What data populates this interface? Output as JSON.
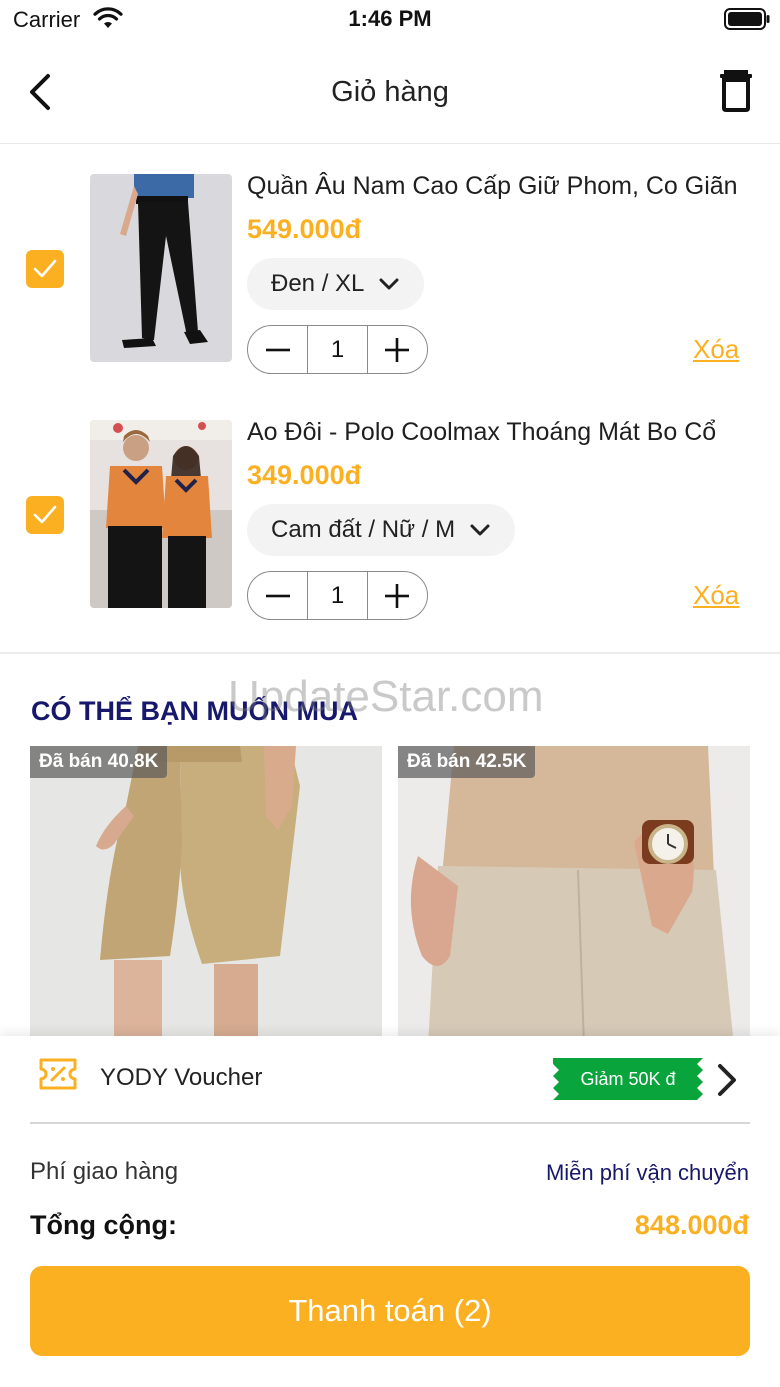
{
  "status_bar": {
    "carrier": "Carrier",
    "time": "1:46 PM"
  },
  "header": {
    "title": "Giỏ hàng",
    "back_icon": "chevron-left-icon",
    "delete_icon": "trash-icon"
  },
  "cart": {
    "items": [
      {
        "name": "Quần Âu Nam Cao Cấp Giữ Phom, Co Giãn",
        "price": "549.000đ",
        "variant": "Đen / XL",
        "quantity": "1",
        "remove_label": "Xóa",
        "checked": true
      },
      {
        "name": "Ao Đôi - Polo Coolmax Thoáng Mát Bo Cổ",
        "price": "349.000đ",
        "variant": "Cam đất / Nữ / M",
        "quantity": "1",
        "remove_label": "Xóa",
        "checked": true
      }
    ]
  },
  "recommend": {
    "title": "CÓ THỂ BẠN MUỐN MUA",
    "products": [
      {
        "sold": "Đã bán 40.8K"
      },
      {
        "sold": "Đã bán 42.5K"
      }
    ]
  },
  "watermark": "UpdateStar.com",
  "summary": {
    "voucher_label": "YODY Voucher",
    "voucher_tag": "Giảm 50K đ",
    "shipping_label": "Phí giao hàng",
    "shipping_value": "Miễn phí vận chuyển",
    "total_label": "Tổng cộng:",
    "total_value": "848.000đ",
    "checkout_label": "Thanh toán (2)"
  },
  "colors": {
    "accent": "#fbb022",
    "navy": "#17186b",
    "voucher_green": "#0aa43c"
  }
}
